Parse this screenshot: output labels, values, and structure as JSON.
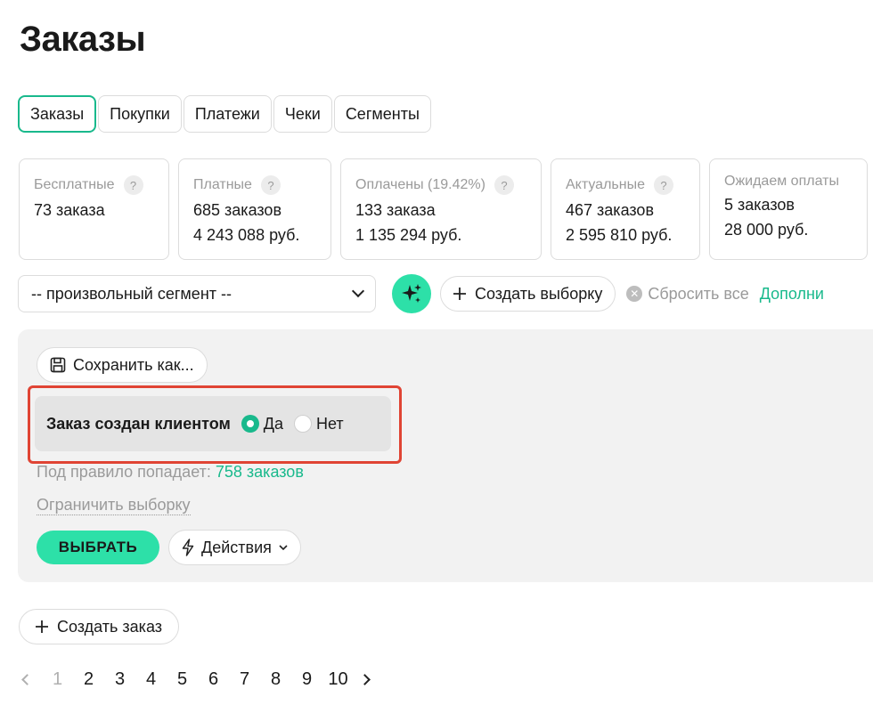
{
  "title": "Заказы",
  "tabs": [
    {
      "label": "Заказы",
      "active": true
    },
    {
      "label": "Покупки",
      "active": false
    },
    {
      "label": "Платежи",
      "active": false
    },
    {
      "label": "Чеки",
      "active": false
    },
    {
      "label": "Сегменты",
      "active": false
    }
  ],
  "stats": [
    {
      "label": "Бесплатные",
      "help": "?",
      "line1": "73 заказа",
      "line2": ""
    },
    {
      "label": "Платные",
      "help": "?",
      "line1": "685 заказов",
      "line2": "4 243 088 руб."
    },
    {
      "label": "Оплачены (19.42%)",
      "help": "?",
      "line1": "133 заказа",
      "line2": "1 135 294 руб."
    },
    {
      "label": "Актуальные",
      "help": "?",
      "line1": "467 заказов",
      "line2": "2 595 810 руб."
    },
    {
      "label": "Ожидаем оплаты",
      "help": "",
      "line1": "5 заказов",
      "line2": "28 000 руб."
    }
  ],
  "filter": {
    "segment_value": "-- произвольный сегмент --",
    "create_selection_label": "Создать выборку",
    "reset_label": "Сбросить все",
    "more_label": "Дополни"
  },
  "panel": {
    "save_label": "Сохранить как...",
    "rule_label": "Заказ создан клиентом",
    "option_yes": "Да",
    "option_no": "Нет",
    "selected_option": "Да",
    "count_prefix": "Под правило попадает:",
    "count_value": "758 заказов",
    "limit_label": "Ограничить выборку",
    "choose_label": "ВЫБРАТЬ",
    "actions_label": "Действия"
  },
  "create_order_label": "Создать заказ",
  "pagination": {
    "current": "1",
    "pages": [
      "1",
      "2",
      "3",
      "4",
      "5",
      "6",
      "7",
      "8",
      "9",
      "10"
    ]
  },
  "colors": {
    "accent": "#19b98c",
    "button_green": "#2de0a8",
    "highlight_red": "#e04434"
  }
}
